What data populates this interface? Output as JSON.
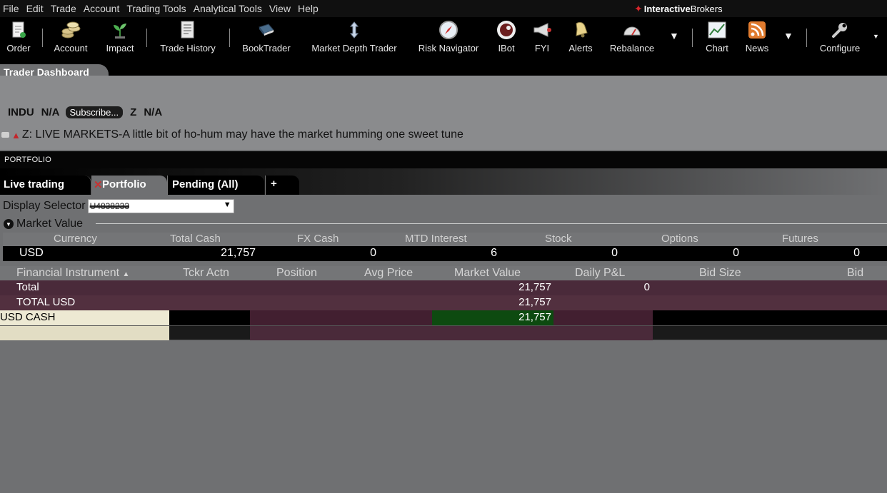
{
  "menu": [
    "File",
    "Edit",
    "Trade",
    "Account",
    "Trading Tools",
    "Analytical Tools",
    "View",
    "Help"
  ],
  "brand": {
    "part1": "Interactive",
    "part2": "Brokers"
  },
  "toolbar": {
    "order": "Order",
    "account": "Account",
    "impact": "Impact",
    "trade_history": "Trade History",
    "booktrader": "BookTrader",
    "market_depth": "Market Depth Trader",
    "risk_navigator": "Risk Navigator",
    "ibot": "IBot",
    "fyi": "FYI",
    "alerts": "Alerts",
    "rebalance": "Rebalance",
    "chart": "Chart",
    "news": "News",
    "configure": "Configure"
  },
  "dashboard": {
    "title": "Trader Dashboard",
    "symbol1": "INDU",
    "value1": "N/A",
    "subscribe": "Subscribe...",
    "symbol2": "Z",
    "value2": "N/A",
    "headline": "Z: LIVE MARKETS-A little bit of ho-hum may have the market humming one sweet tune"
  },
  "portfolio": {
    "header": "PORTFOLIO",
    "tabs": {
      "live": "Live trading",
      "portfolio": "Portfolio",
      "pending": "Pending (All)",
      "plus": "+"
    },
    "display_selector_label": "Display Selector",
    "display_selector_value": "U4838233",
    "market_value": {
      "title": "Market Value",
      "columns": [
        "Currency",
        "Total Cash",
        "FX Cash",
        "MTD Interest",
        "Stock",
        "Options",
        "Futures"
      ],
      "row": {
        "currency": "USD",
        "total_cash": "21,757",
        "fx_cash": "0",
        "mtd_interest": "6",
        "stock": "0",
        "options": "0",
        "futures": "0"
      }
    },
    "instruments": {
      "columns": {
        "instrument": "Financial Instrument",
        "sort_arrow": "▲",
        "tckr": "Tckr Actn",
        "position": "Position",
        "avg_price": "Avg Price",
        "market_value": "Market Value",
        "daily_pl": "Daily P&L",
        "bid_size": "Bid Size",
        "bid": "Bid"
      },
      "rows": [
        {
          "name": "Total",
          "market_value": "21,757",
          "daily_pl": "0"
        },
        {
          "name": "TOTAL   USD",
          "market_value": "21,757"
        },
        {
          "name": "USD CASH",
          "market_value": "21,757"
        }
      ]
    }
  },
  "colors": {
    "cash_row_value_bg": "#0d4a10",
    "cash_row_name_bg": "#ede9d3",
    "total_row_bg": "#4a2a3a"
  }
}
